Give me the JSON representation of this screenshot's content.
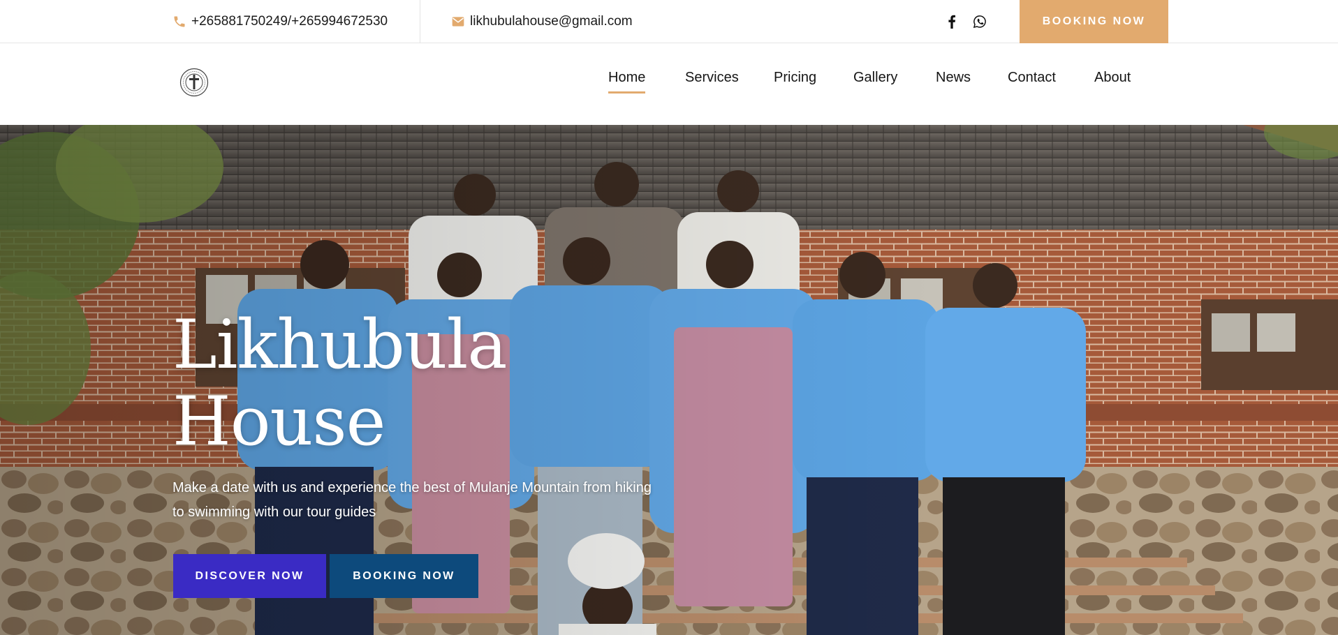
{
  "topbar": {
    "phone": "+265881750249/+265994672530",
    "phone_icon": "phone-icon",
    "email": "likhubulahouse@gmail.com",
    "email_icon": "envelope-icon",
    "social_icons": [
      "facebook-icon",
      "whatsapp-icon"
    ],
    "booking_label": "BOOKING NOW"
  },
  "nav": {
    "logo_icon": "cross-seal-logo",
    "items": [
      {
        "label": "Home",
        "active": true
      },
      {
        "label": "Services"
      },
      {
        "label": "Pricing"
      },
      {
        "label": "Gallery"
      },
      {
        "label": "News"
      },
      {
        "label": "Contact"
      },
      {
        "label": "About"
      }
    ]
  },
  "hero": {
    "title_line1": "Likhubula",
    "title_line2": "House",
    "subtitle": "Make a date with us and experience the best of Mulanje Mountain from hiking to swimming with our tour guides",
    "discover_label": "DISCOVER NOW",
    "booking_label": "BOOKING NOW"
  },
  "colors": {
    "accent": "#e2aa6e",
    "discover_button": "#3a2bc4",
    "booking_button": "#0d4a7c",
    "text_dark": "#151515"
  }
}
